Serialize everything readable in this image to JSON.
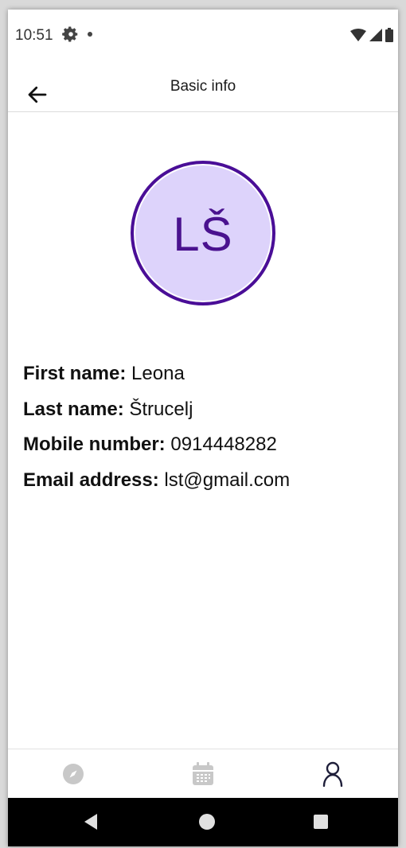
{
  "status_bar": {
    "time": "10:51",
    "icons": [
      "settings-icon",
      "notification-dot-icon",
      "wifi-icon",
      "signal-icon",
      "battery-icon"
    ]
  },
  "app_bar": {
    "title": "Basic info",
    "back_icon": "arrow-left-icon"
  },
  "avatar": {
    "initials": "LŠ",
    "fill_color": "#ddd3fb",
    "border_color": "#4a0e97"
  },
  "profile": {
    "first_name_label": "First name:",
    "first_name": "Leona",
    "last_name_label": "Last name:",
    "last_name": "Štrucelj",
    "mobile_label": "Mobile number:",
    "mobile": "0914448282",
    "email_label": "Email address:",
    "email": "lst@gmail.com"
  },
  "bottom_nav": {
    "items": [
      {
        "icon": "compass-icon",
        "active": false
      },
      {
        "icon": "calendar-icon",
        "active": false
      },
      {
        "icon": "profile-icon",
        "active": true
      }
    ]
  },
  "system_nav": [
    "back-triangle-icon",
    "home-circle-icon",
    "recents-square-icon"
  ]
}
